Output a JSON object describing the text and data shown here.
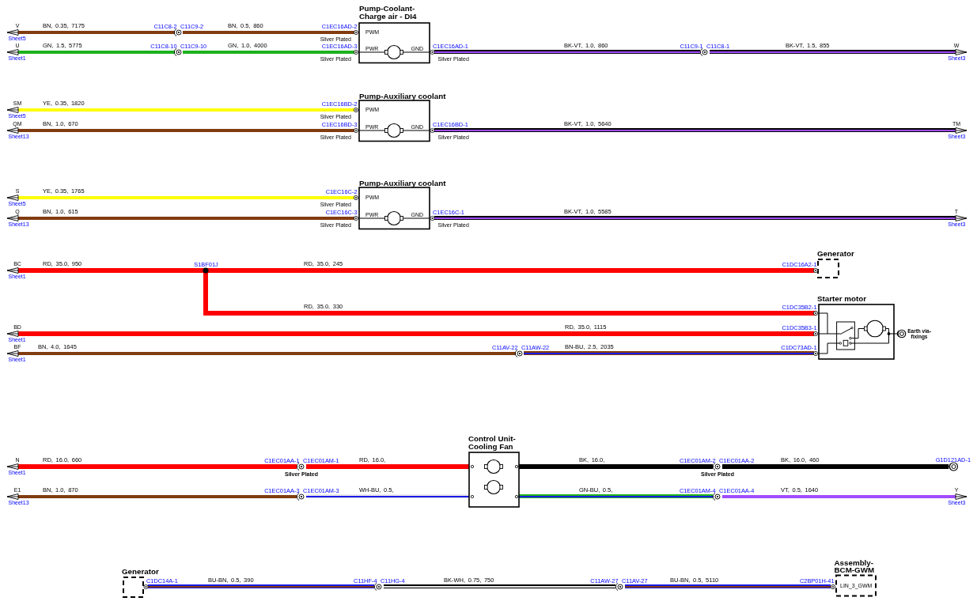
{
  "components": [
    {
      "kind": "pump",
      "title": [
        "Pump-Coolant-",
        "Charge air - DI4"
      ],
      "inner_labels": [
        "PWM",
        "PWR",
        "GND"
      ],
      "terminals": [
        {
          "label": "C1EC16AD-2",
          "note": "Silver Plated"
        },
        {
          "label": "C1EC16AD-3",
          "note": "Silver Plated"
        },
        {
          "label": "C1EC16AD-1",
          "note": "Silver Plated"
        }
      ]
    },
    {
      "kind": "pump",
      "title": [
        "Pump-Auxiliary coolant"
      ],
      "inner_labels": [
        "PWM",
        "PWR",
        "GND"
      ],
      "terminals": [
        {
          "label": "C1EC16BD-2",
          "note": "Silver Plated"
        },
        {
          "label": "C1EC16BD-3",
          "note": "Silver Plated"
        },
        {
          "label": "C1EC16BD-1",
          "note": "Silver Plated"
        }
      ]
    },
    {
      "kind": "pump",
      "title": [
        "Pump-Auxiliary coolant"
      ],
      "inner_labels": [
        "PWM",
        "PWR",
        "GND"
      ],
      "terminals": [
        {
          "label": "C1EC16C-2",
          "note": "Silver Plated"
        },
        {
          "label": "C1EC16C-3",
          "note": "Silver Plated"
        },
        {
          "label": "C1EC16C-1",
          "note": "Silver Plated"
        }
      ]
    },
    {
      "kind": "generator",
      "title": [
        "Generator"
      ],
      "terminals": [
        {
          "label": "C1DC16A2-1"
        }
      ]
    },
    {
      "kind": "starter_motor",
      "title": [
        "Starter motor"
      ],
      "terminals": [
        {
          "label": "C1DC35B2-1"
        },
        {
          "label": "C1DC35B3-1"
        },
        {
          "label": "C1DC73AD-1"
        }
      ],
      "earth_label": [
        "Earth via-",
        "fixings"
      ]
    },
    {
      "kind": "fan_control_unit",
      "title": [
        "Control Unit-",
        "Cooling Fan"
      ]
    },
    {
      "kind": "generator",
      "title": [
        "Generator"
      ],
      "terminals": [
        {
          "label": "C1DC14A-1"
        }
      ]
    },
    {
      "kind": "module",
      "title": [
        "Assembly-",
        "BCM-GWM"
      ],
      "inner_labels": [
        "LIN_3_GWM"
      ],
      "terminals": [
        {
          "label": "C2BP01H-41"
        }
      ]
    }
  ],
  "wires": [
    {
      "label": "BN, 0.35, 7175",
      "color": "#803c10",
      "heavy": false
    },
    {
      "label": "BN, 0.5, 860",
      "color": "#803c10",
      "heavy": false
    },
    {
      "label": "GN, 1.5, 5775",
      "color": "#1db11d",
      "heavy": false
    },
    {
      "label": "GN, 1.0, 4000",
      "color": "#1db11d",
      "heavy": false
    },
    {
      "label": "BK-VT, 1.0, 860",
      "color": "#000000",
      "stripe": {
        "color": "#a04cff"
      },
      "heavy": false
    },
    {
      "label": "BK-VT, 1.5, 855",
      "color": "#000000",
      "stripe": {
        "color": "#a04cff"
      },
      "heavy": false
    },
    {
      "label": "YE, 0.35, 1820",
      "color": "#ffff00",
      "heavy": false
    },
    {
      "label": "BN, 1.0, 670",
      "color": "#803c10",
      "heavy": false
    },
    {
      "label": "BK-VT, 1.0, 5640",
      "color": "#000000",
      "stripe": {
        "color": "#a04cff"
      },
      "heavy": false
    },
    {
      "label": "YE, 0.35, 1765",
      "color": "#ffff00",
      "heavy": false
    },
    {
      "label": "BN, 1.0, 615",
      "color": "#803c10",
      "heavy": false
    },
    {
      "label": "BK-VT, 1.0, 5585",
      "color": "#000000",
      "stripe": {
        "color": "#a04cff"
      },
      "heavy": false
    },
    {
      "label": "RD, 35.0, 950",
      "color": "#ff0000",
      "heavy": true
    },
    {
      "label": "RD, 35.0, 245",
      "color": "#ff0000",
      "heavy": true
    },
    {
      "label": "RD, 35.0, 330",
      "color": "#ff0000",
      "heavy": true
    },
    {
      "label": "RD, 35.0, 1115",
      "color": "#ff0000",
      "heavy": true
    },
    {
      "label": "BN, 4.0, 1645",
      "color": "#803c10",
      "heavy": false
    },
    {
      "label": "BN-BU, 2.5, 2035",
      "color": "#803c10",
      "stripe": {
        "color": "#1a1ae6"
      },
      "heavy": false
    },
    {
      "label": "RD, 16.0, 660",
      "color": "#ff0000",
      "heavy": true
    },
    {
      "label": "RD, 16.0,",
      "color": "#ff0000",
      "heavy": true
    },
    {
      "label": "BK, 16.0,",
      "color": "#000000",
      "heavy": true
    },
    {
      "label": "BK, 16.0, 460",
      "color": "#000000",
      "heavy": true
    },
    {
      "label": "BN, 1.0, 870",
      "color": "#803c10",
      "heavy": false
    },
    {
      "label": "WH-BU, 0.5,",
      "color": "#e8e8e8",
      "stripe": {
        "color": "#1a1ae6"
      },
      "heavy": false
    },
    {
      "label": "GN-BU, 0.5,",
      "color": "#1db11d",
      "stripe": {
        "color": "#1a1ae6"
      },
      "heavy": false
    },
    {
      "label": "VT, 0.5, 1640",
      "color": "#a04cff",
      "heavy": false
    },
    {
      "label": "BU-BN, 0.5, 390",
      "color": "#1a1ae6",
      "stripe": {
        "color": "#803c10"
      },
      "heavy": false
    },
    {
      "label": "BK-WH, 0.75, 750",
      "color": "#000000",
      "stripe": {
        "color": "#e8e8e8"
      },
      "heavy": false
    },
    {
      "label": "BU-BN, 0.5, 5110",
      "color": "#1a1ae6",
      "stripe": {
        "color": "#803c10"
      },
      "heavy": false
    }
  ],
  "inline_connectors": [
    {
      "left_label": "C11C8-2",
      "right_label": "C11C9-2"
    },
    {
      "left_label": "C11C8-10",
      "right_label": "C11C9-10"
    },
    {
      "left_label": "C11C9-1",
      "right_label": "C11C8-1"
    },
    {
      "left_label": "C11AV-22",
      "right_label": "C11AW-22"
    },
    {
      "left_label": "C1EC01AA-1",
      "right_label": "C1EC01AM-1",
      "note": "Silver Plated"
    },
    {
      "left_label": "C1EC01AM-2",
      "right_label": "C1EC01AA-2",
      "note": "Silver Plated"
    },
    {
      "left_label": "C1EC01AA-3",
      "right_label": "C1EC01AM-3"
    },
    {
      "left_label": "C1EC01AM-4",
      "right_label": "C1EC01AA-4"
    },
    {
      "left_label": "C11HF-4",
      "right_label": "C11HG-4"
    },
    {
      "left_label": "C11AW-27",
      "right_label": "C11AV-27"
    }
  ],
  "off_sheet_references": [
    {
      "signal": "V",
      "sheet": "Sheet5"
    },
    {
      "signal": "U",
      "sheet": "Sheet1"
    },
    {
      "signal": "W",
      "sheet": "Sheet3"
    },
    {
      "signal": "SM",
      "sheet": "Sheet5"
    },
    {
      "signal": "QM",
      "sheet": "Sheet13"
    },
    {
      "signal": "TM",
      "sheet": "Sheet3"
    },
    {
      "signal": "S",
      "sheet": "Sheet5"
    },
    {
      "signal": "Q",
      "sheet": "Sheet13"
    },
    {
      "signal": "T",
      "sheet": "Sheet3"
    },
    {
      "signal": "BC",
      "sheet": "Sheet1"
    },
    {
      "signal": "BD",
      "sheet": "Sheet1"
    },
    {
      "signal": "BF",
      "sheet": "Sheet1"
    },
    {
      "signal": "N",
      "sheet": "Sheet1"
    },
    {
      "signal": "E1",
      "sheet": "Sheet13"
    },
    {
      "signal": "Y",
      "sheet": "Sheet3"
    }
  ],
  "splice": {
    "label": "S1BF01J"
  },
  "ground_point": {
    "label": "G1D121AD-1"
  }
}
